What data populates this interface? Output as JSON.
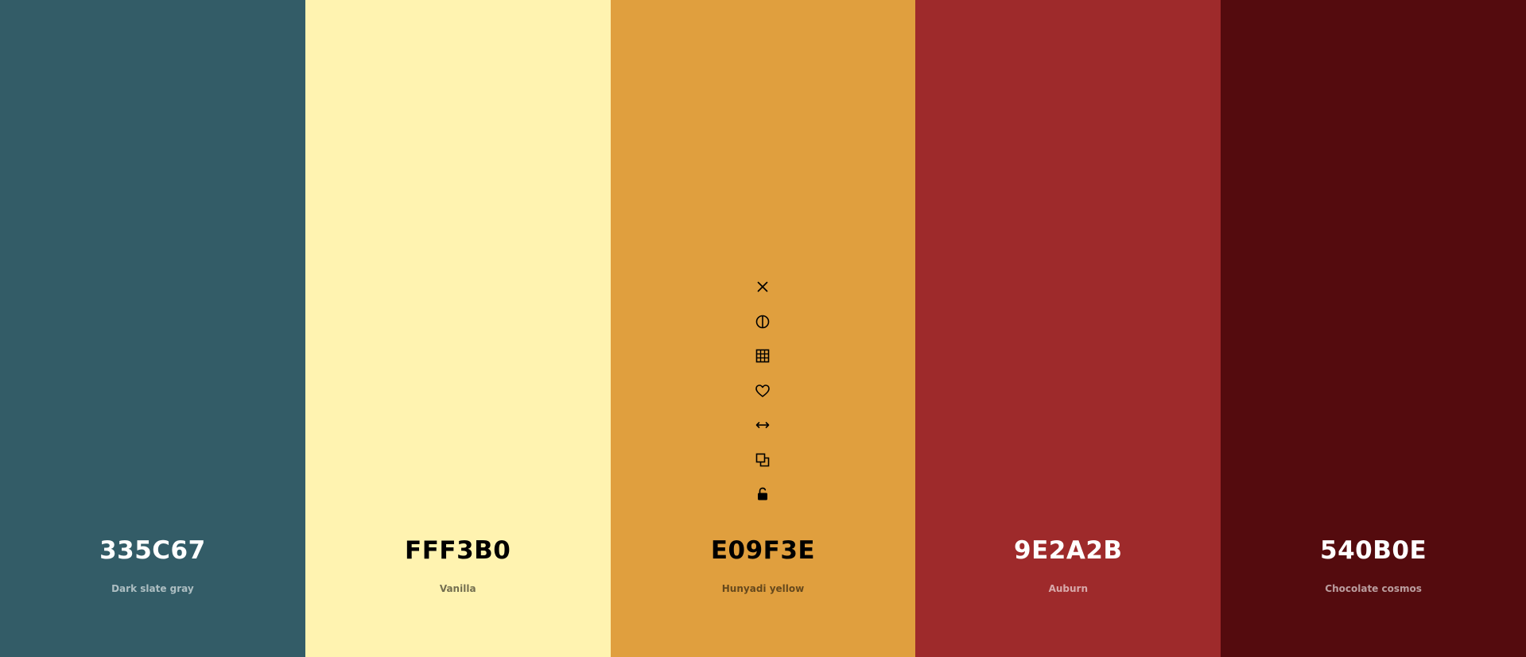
{
  "palette": {
    "colors": [
      {
        "hex": "335C67",
        "name": "Dark slate gray",
        "color": "#335C67",
        "text_tone": "dark"
      },
      {
        "hex": "FFF3B0",
        "name": "Vanilla",
        "color": "#FFF3B0",
        "text_tone": "light"
      },
      {
        "hex": "E09F3E",
        "name": "Hunyadi yellow",
        "color": "#E09F3E",
        "text_tone": "light"
      },
      {
        "hex": "9E2A2B",
        "name": "Auburn",
        "color": "#9E2A2B",
        "text_tone": "dark"
      },
      {
        "hex": "540B0E",
        "name": "Chocolate cosmos",
        "color": "#540B0E",
        "text_tone": "dark"
      }
    ]
  },
  "toolbar": {
    "attached_to_swatch": 3,
    "tools": [
      {
        "icon": "close-icon",
        "action": "remove"
      },
      {
        "icon": "contrast-icon",
        "action": "shades"
      },
      {
        "icon": "grid-icon",
        "action": "view-grid"
      },
      {
        "icon": "heart-icon",
        "action": "favorite"
      },
      {
        "icon": "drag-arrows-icon",
        "action": "drag"
      },
      {
        "icon": "copy-icon",
        "action": "copy"
      },
      {
        "icon": "unlock-icon",
        "action": "lock"
      }
    ]
  }
}
